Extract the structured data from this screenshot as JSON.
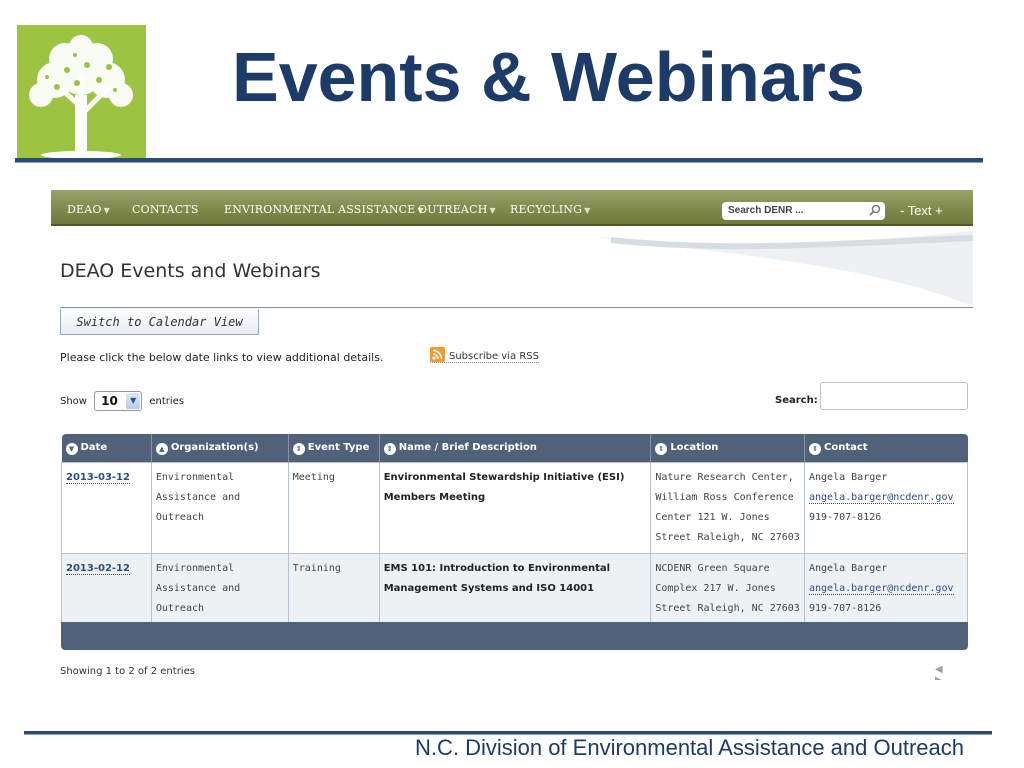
{
  "slide": {
    "title": "Events & Webinars",
    "footer": "N.C. Division of Environmental Assistance and Outreach"
  },
  "nav": {
    "items": [
      {
        "label": "DEAO",
        "dropdown": true
      },
      {
        "label": "CONTACTS",
        "dropdown": false
      },
      {
        "label": "ENVIRONMENTAL ASSISTANCE",
        "dropdown": true
      },
      {
        "label": "OUTREACH",
        "dropdown": true
      },
      {
        "label": "RECYCLING",
        "dropdown": true
      }
    ],
    "search_placeholder": "Search DENR ...",
    "text_size": "- Text +"
  },
  "page": {
    "heading": "DEAO Events and Webinars",
    "calendar_button": "Switch to Calendar View",
    "intro": "Please click the below date links to view additional details.",
    "rss": "Subscribe via RSS",
    "show_label": "Show",
    "entries_value": "10",
    "entries_label": "entries",
    "search_label": "Search:",
    "showing": "Showing 1 to 2 of 2 entries",
    "pager": "◀ ▶"
  },
  "table": {
    "columns": [
      "Date",
      "Organization(s)",
      "Event Type",
      "Name / Brief Description",
      "Location",
      "Contact"
    ],
    "rows": [
      {
        "date": "2013-03-12",
        "organization": "Environmental Assistance and Outreach",
        "event_type": "Meeting",
        "name": "Environmental Stewardship Initiative (ESI) Members Meeting",
        "location": "Nature Research Center, William Ross Conference Center 121 W. Jones Street Raleigh, NC 27603",
        "contact_name": "Angela Barger",
        "contact_email": "angela.barger@ncdenr.gov",
        "contact_phone": "919-707-8126"
      },
      {
        "date": "2013-02-12",
        "organization": "Environmental Assistance and Outreach",
        "event_type": "Training",
        "name": "EMS 101: Introduction to Environmental Management Systems and ISO 14001",
        "location": "NCDENR Green Square Complex 217 W. Jones Street Raleigh, NC 27603",
        "contact_name": "Angela Barger",
        "contact_email": "angela.barger@ncdenr.gov",
        "contact_phone": "919-707-8126"
      }
    ]
  },
  "colors": {
    "title": "#1d3b69",
    "logo_bg": "#9cc442",
    "nav_bg": "#7f8a4b",
    "table_header": "#50627a",
    "link": "#2b4f85"
  }
}
